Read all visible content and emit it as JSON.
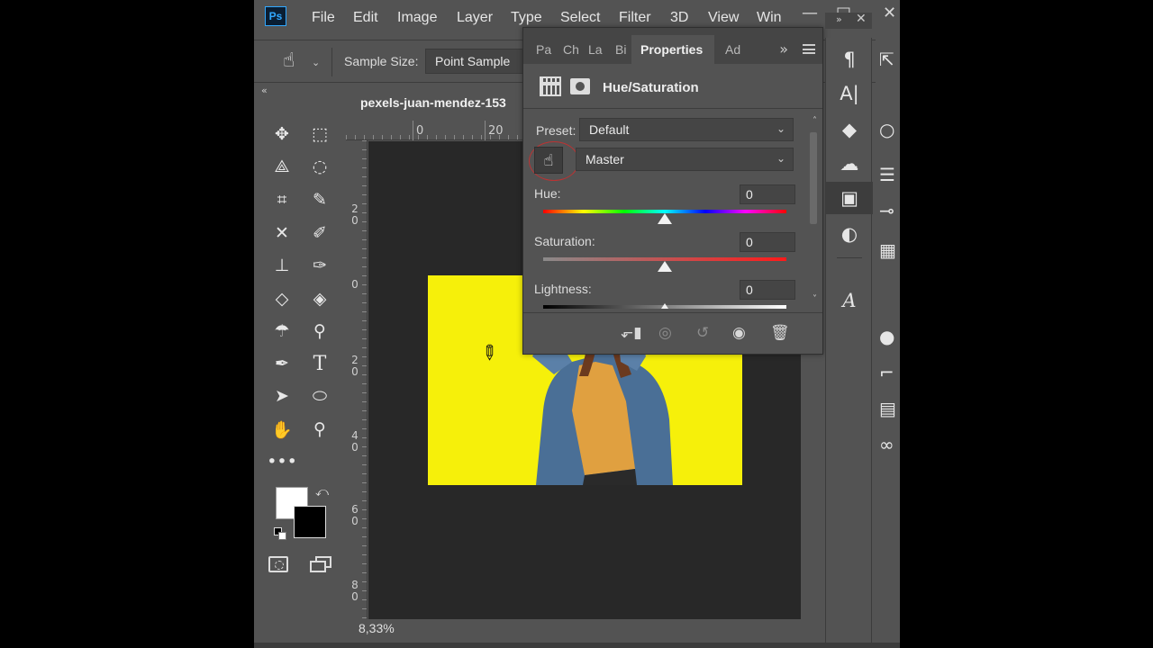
{
  "menu": {
    "logo": "Ps",
    "items": [
      "File",
      "Edit",
      "Image",
      "Layer",
      "Type",
      "Select",
      "Filter",
      "3D",
      "View",
      "Win"
    ]
  },
  "window_controls": {
    "minimize": "—",
    "maximize": "□",
    "close": "✕"
  },
  "options_bar": {
    "tool_icon": "hand-pointer-icon",
    "sample_size_label": "Sample Size:",
    "sample_size_value": "Point Sample"
  },
  "document": {
    "title": "pexels-juan-mendez-153",
    "zoom": "8,33%",
    "ruler_top_labels": [
      "0",
      "20"
    ],
    "ruler_left_labels": [
      "2\n0",
      "0",
      "2\n0",
      "4\n0",
      "6\n0",
      "8\n0"
    ]
  },
  "properties_panel": {
    "tabs": [
      "Pa",
      "Ch",
      "La",
      "Bi"
    ],
    "active_tab": "Properties",
    "extra_tab": "Ad",
    "adjustment_title": "Hue/Saturation",
    "preset_label": "Preset:",
    "preset_value": "Default",
    "channel_value": "Master",
    "sliders": [
      {
        "label": "Hue:",
        "value": "0",
        "level": 0.5
      },
      {
        "label": "Saturation:",
        "value": "0",
        "level": 0.5
      },
      {
        "label": "Lightness:",
        "value": "0",
        "level": 0.5
      }
    ]
  },
  "colors": {
    "foreground": "#ffffff",
    "background": "#000000",
    "photo_background": "#f6f00a",
    "accent": "#31a8ff"
  }
}
